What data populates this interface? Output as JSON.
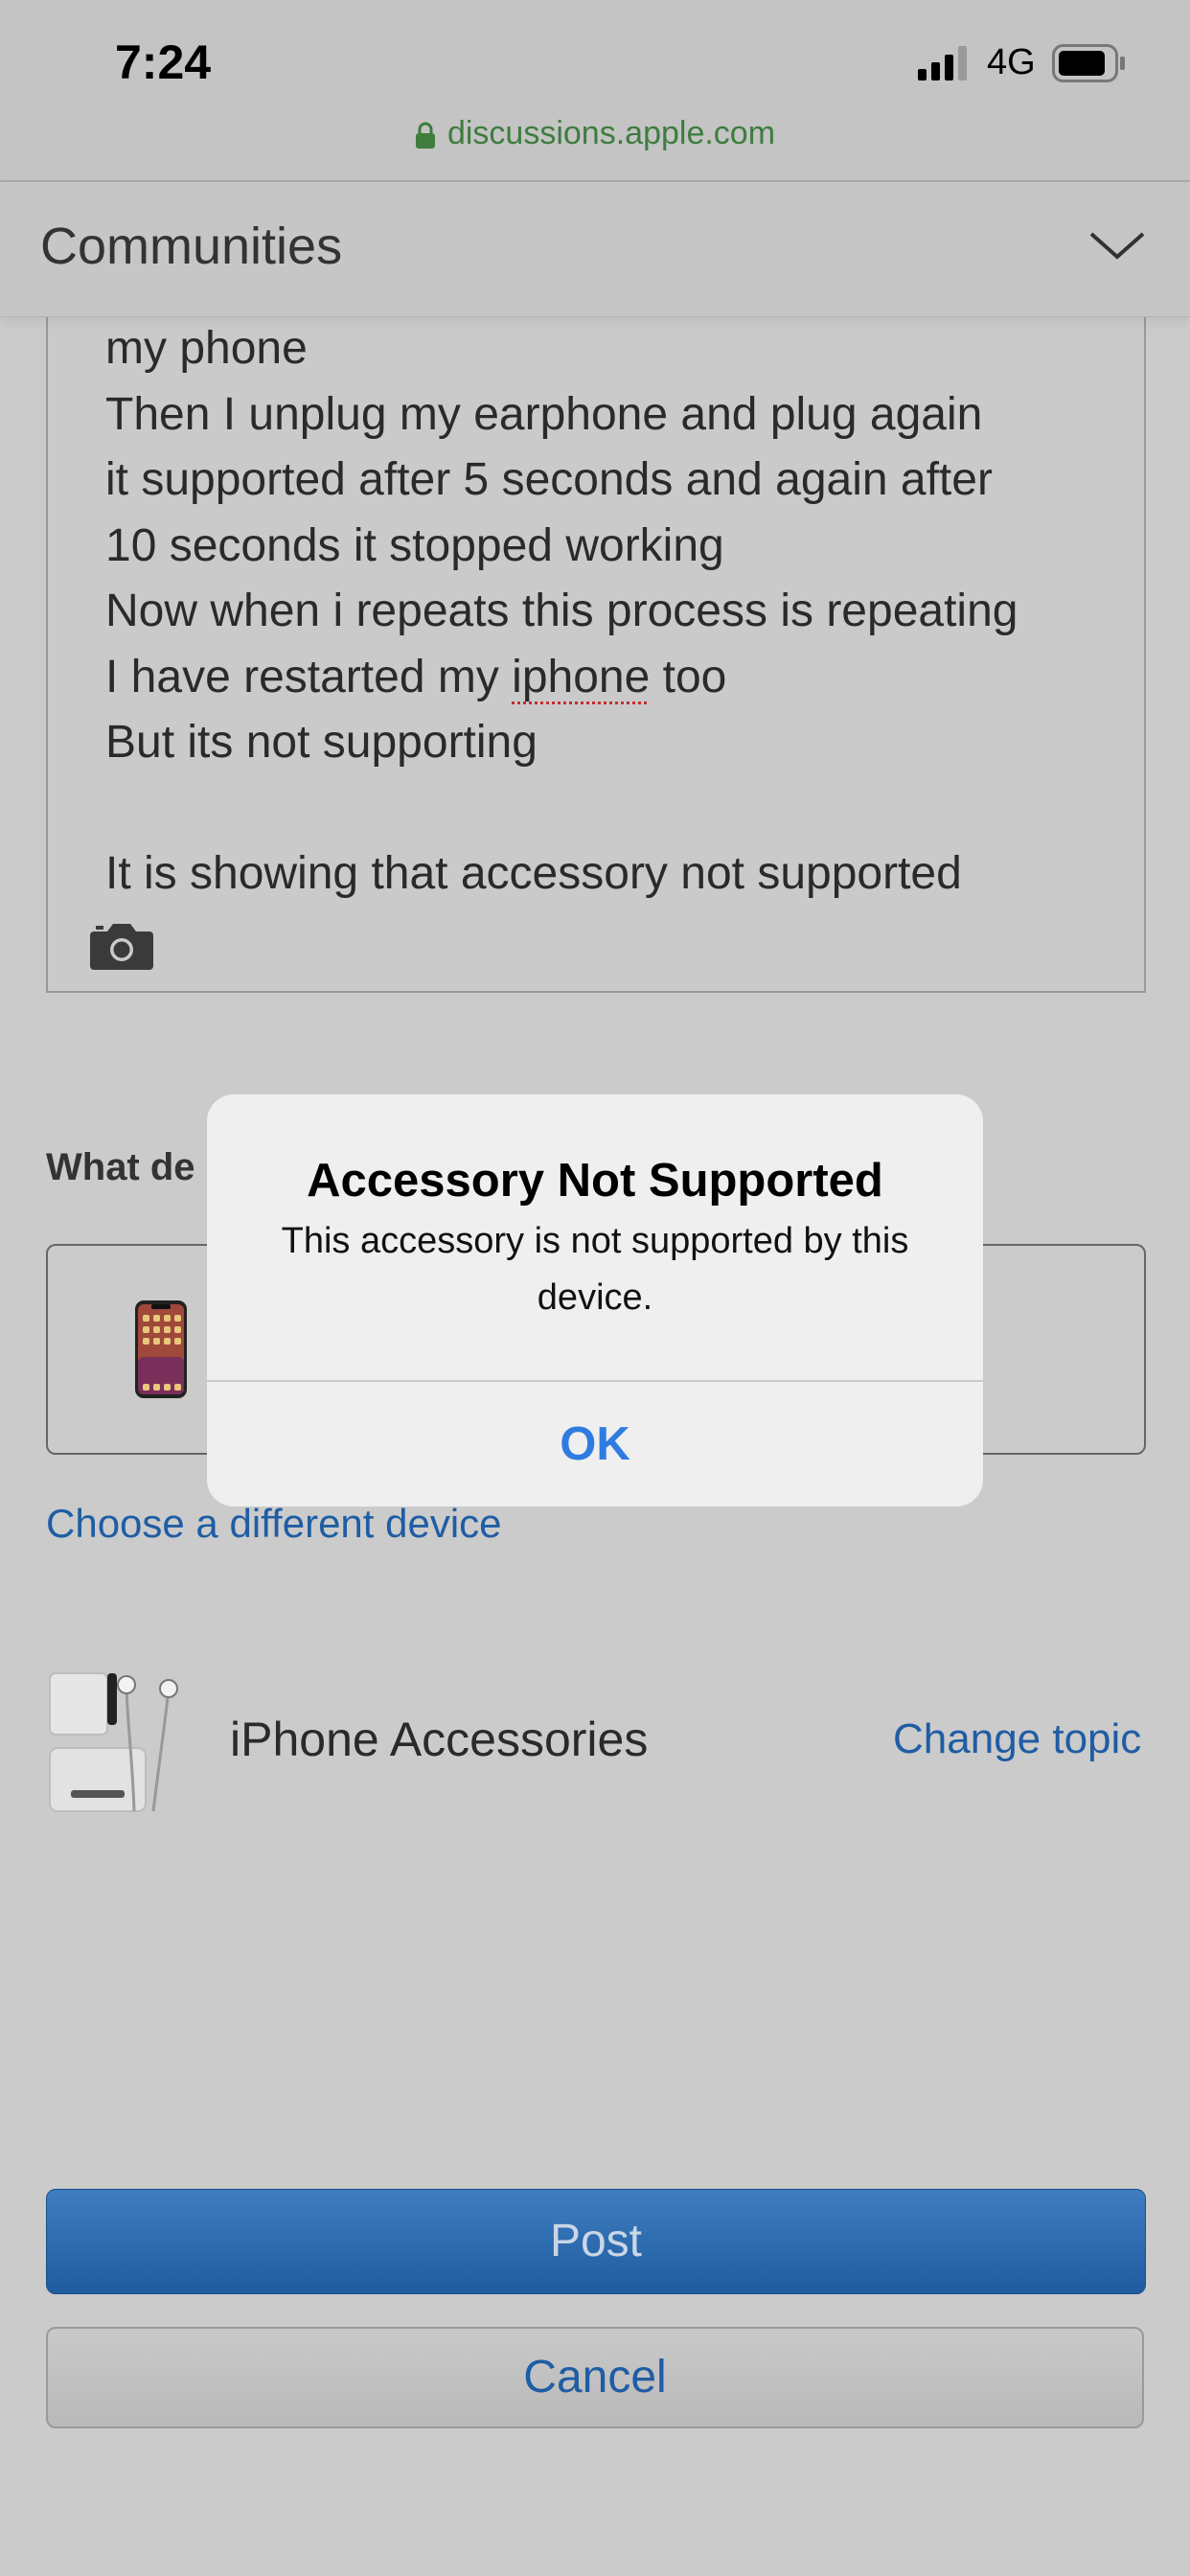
{
  "status_bar": {
    "time": "7:24",
    "network": "4G",
    "url": "discussions.apple.com",
    "signal_icon": "cellular-signal-icon",
    "battery_icon": "battery-icon",
    "lock_icon": "lock-icon"
  },
  "header": {
    "title": "Communities",
    "menu_icon": "chevron-down-icon"
  },
  "editor": {
    "lines": [
      "my phone",
      "Then I unplug my earphone and plug again",
      "it supported after 5 seconds and again after",
      "10 seconds it stopped working",
      "Now when i repeats this process is repeating",
      "I have restarted my ",
      "iphone",
      " too",
      "But its not supporting",
      "It is showing that accessory not supported"
    ],
    "camera_icon": "camera-icon"
  },
  "device": {
    "label": "What de",
    "choose_link": "Choose a different device"
  },
  "topic": {
    "name": "iPhone Accessories",
    "change_link": "Change topic"
  },
  "actions": {
    "post": "Post",
    "cancel": "Cancel"
  },
  "alert": {
    "title": "Accessory Not Supported",
    "message": "This accessory is not supported by this device.",
    "ok": "OK"
  },
  "colors": {
    "link": "#1f5da4",
    "alert_button": "#2f7ce0",
    "url_green": "#3e7d3e",
    "post_button": "#2a6ab2"
  }
}
